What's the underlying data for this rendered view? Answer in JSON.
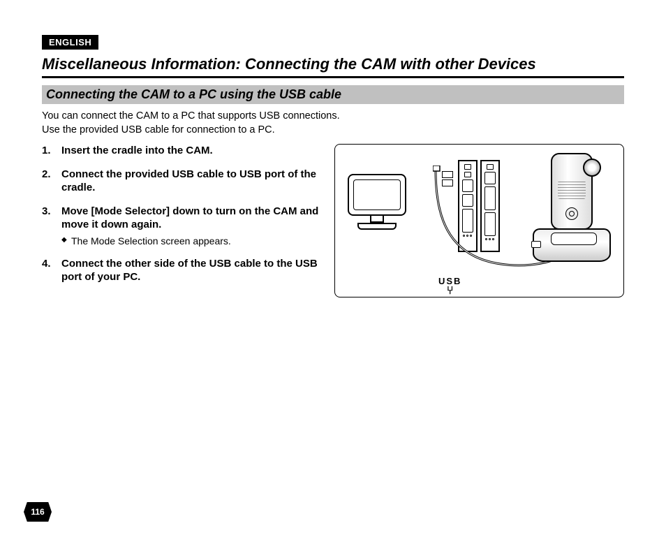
{
  "language_tag": "ENGLISH",
  "main_heading": "Miscellaneous Information: Connecting the CAM with other Devices",
  "sub_heading": "Connecting the CAM to a PC using the USB cable",
  "intro_line1": "You can connect the CAM to a PC that supports USB connections.",
  "intro_line2": "Use the provided USB cable for connection to a PC.",
  "steps": [
    {
      "text": "Insert the cradle into the CAM."
    },
    {
      "text": "Connect the provided USB cable to USB port of the cradle."
    },
    {
      "text": "Move [Mode Selector] down to turn on the CAM and move it down again.",
      "sub": "The Mode Selection screen appears."
    },
    {
      "text": "Connect the other side of the USB cable to the USB port of your PC."
    }
  ],
  "usb_label": "USB",
  "page_number": "116"
}
